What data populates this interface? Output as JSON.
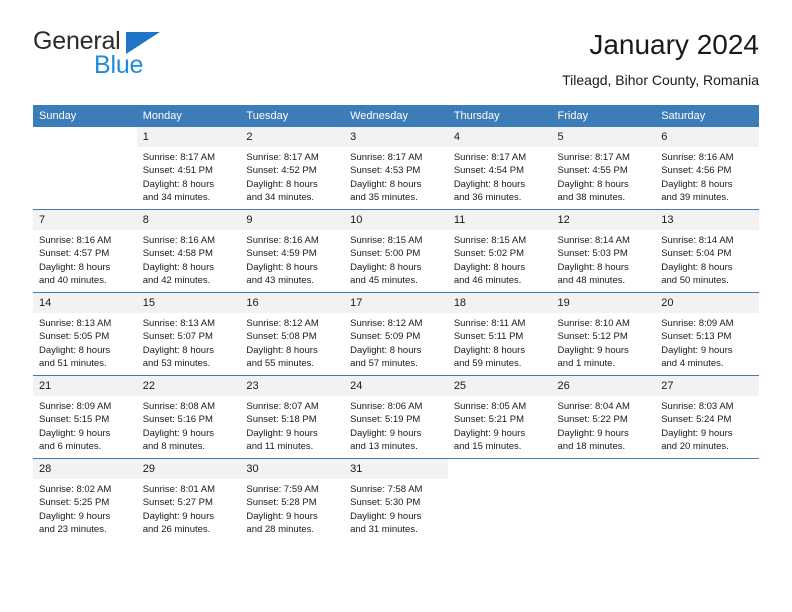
{
  "brand": {
    "name_part1": "General",
    "name_part2": "Blue",
    "triangle_color": "#1f76c6",
    "blue_color": "#1f8bdb"
  },
  "header": {
    "title": "January 2024",
    "subtitle": "Tileagd, Bihor County, Romania"
  },
  "theme": {
    "header_blue": "#3b7cb9",
    "daynum_band": "#f2f2f2",
    "text": "#1a1a1a"
  },
  "weekday_headers": [
    "Sunday",
    "Monday",
    "Tuesday",
    "Wednesday",
    "Thursday",
    "Friday",
    "Saturday"
  ],
  "weeks": [
    [
      {
        "day": "",
        "blank": true,
        "sunrise": "",
        "sunset": "",
        "daylight1": "",
        "daylight2": ""
      },
      {
        "day": "1",
        "sunrise": "Sunrise: 8:17 AM",
        "sunset": "Sunset: 4:51 PM",
        "daylight1": "Daylight: 8 hours",
        "daylight2": "and 34 minutes."
      },
      {
        "day": "2",
        "sunrise": "Sunrise: 8:17 AM",
        "sunset": "Sunset: 4:52 PM",
        "daylight1": "Daylight: 8 hours",
        "daylight2": "and 34 minutes."
      },
      {
        "day": "3",
        "sunrise": "Sunrise: 8:17 AM",
        "sunset": "Sunset: 4:53 PM",
        "daylight1": "Daylight: 8 hours",
        "daylight2": "and 35 minutes."
      },
      {
        "day": "4",
        "sunrise": "Sunrise: 8:17 AM",
        "sunset": "Sunset: 4:54 PM",
        "daylight1": "Daylight: 8 hours",
        "daylight2": "and 36 minutes."
      },
      {
        "day": "5",
        "sunrise": "Sunrise: 8:17 AM",
        "sunset": "Sunset: 4:55 PM",
        "daylight1": "Daylight: 8 hours",
        "daylight2": "and 38 minutes."
      },
      {
        "day": "6",
        "sunrise": "Sunrise: 8:16 AM",
        "sunset": "Sunset: 4:56 PM",
        "daylight1": "Daylight: 8 hours",
        "daylight2": "and 39 minutes."
      }
    ],
    [
      {
        "day": "7",
        "sunrise": "Sunrise: 8:16 AM",
        "sunset": "Sunset: 4:57 PM",
        "daylight1": "Daylight: 8 hours",
        "daylight2": "and 40 minutes."
      },
      {
        "day": "8",
        "sunrise": "Sunrise: 8:16 AM",
        "sunset": "Sunset: 4:58 PM",
        "daylight1": "Daylight: 8 hours",
        "daylight2": "and 42 minutes."
      },
      {
        "day": "9",
        "sunrise": "Sunrise: 8:16 AM",
        "sunset": "Sunset: 4:59 PM",
        "daylight1": "Daylight: 8 hours",
        "daylight2": "and 43 minutes."
      },
      {
        "day": "10",
        "sunrise": "Sunrise: 8:15 AM",
        "sunset": "Sunset: 5:00 PM",
        "daylight1": "Daylight: 8 hours",
        "daylight2": "and 45 minutes."
      },
      {
        "day": "11",
        "sunrise": "Sunrise: 8:15 AM",
        "sunset": "Sunset: 5:02 PM",
        "daylight1": "Daylight: 8 hours",
        "daylight2": "and 46 minutes."
      },
      {
        "day": "12",
        "sunrise": "Sunrise: 8:14 AM",
        "sunset": "Sunset: 5:03 PM",
        "daylight1": "Daylight: 8 hours",
        "daylight2": "and 48 minutes."
      },
      {
        "day": "13",
        "sunrise": "Sunrise: 8:14 AM",
        "sunset": "Sunset: 5:04 PM",
        "daylight1": "Daylight: 8 hours",
        "daylight2": "and 50 minutes."
      }
    ],
    [
      {
        "day": "14",
        "sunrise": "Sunrise: 8:13 AM",
        "sunset": "Sunset: 5:05 PM",
        "daylight1": "Daylight: 8 hours",
        "daylight2": "and 51 minutes."
      },
      {
        "day": "15",
        "sunrise": "Sunrise: 8:13 AM",
        "sunset": "Sunset: 5:07 PM",
        "daylight1": "Daylight: 8 hours",
        "daylight2": "and 53 minutes."
      },
      {
        "day": "16",
        "sunrise": "Sunrise: 8:12 AM",
        "sunset": "Sunset: 5:08 PM",
        "daylight1": "Daylight: 8 hours",
        "daylight2": "and 55 minutes."
      },
      {
        "day": "17",
        "sunrise": "Sunrise: 8:12 AM",
        "sunset": "Sunset: 5:09 PM",
        "daylight1": "Daylight: 8 hours",
        "daylight2": "and 57 minutes."
      },
      {
        "day": "18",
        "sunrise": "Sunrise: 8:11 AM",
        "sunset": "Sunset: 5:11 PM",
        "daylight1": "Daylight: 8 hours",
        "daylight2": "and 59 minutes."
      },
      {
        "day": "19",
        "sunrise": "Sunrise: 8:10 AM",
        "sunset": "Sunset: 5:12 PM",
        "daylight1": "Daylight: 9 hours",
        "daylight2": "and 1 minute."
      },
      {
        "day": "20",
        "sunrise": "Sunrise: 8:09 AM",
        "sunset": "Sunset: 5:13 PM",
        "daylight1": "Daylight: 9 hours",
        "daylight2": "and 4 minutes."
      }
    ],
    [
      {
        "day": "21",
        "sunrise": "Sunrise: 8:09 AM",
        "sunset": "Sunset: 5:15 PM",
        "daylight1": "Daylight: 9 hours",
        "daylight2": "and 6 minutes."
      },
      {
        "day": "22",
        "sunrise": "Sunrise: 8:08 AM",
        "sunset": "Sunset: 5:16 PM",
        "daylight1": "Daylight: 9 hours",
        "daylight2": "and 8 minutes."
      },
      {
        "day": "23",
        "sunrise": "Sunrise: 8:07 AM",
        "sunset": "Sunset: 5:18 PM",
        "daylight1": "Daylight: 9 hours",
        "daylight2": "and 11 minutes."
      },
      {
        "day": "24",
        "sunrise": "Sunrise: 8:06 AM",
        "sunset": "Sunset: 5:19 PM",
        "daylight1": "Daylight: 9 hours",
        "daylight2": "and 13 minutes."
      },
      {
        "day": "25",
        "sunrise": "Sunrise: 8:05 AM",
        "sunset": "Sunset: 5:21 PM",
        "daylight1": "Daylight: 9 hours",
        "daylight2": "and 15 minutes."
      },
      {
        "day": "26",
        "sunrise": "Sunrise: 8:04 AM",
        "sunset": "Sunset: 5:22 PM",
        "daylight1": "Daylight: 9 hours",
        "daylight2": "and 18 minutes."
      },
      {
        "day": "27",
        "sunrise": "Sunrise: 8:03 AM",
        "sunset": "Sunset: 5:24 PM",
        "daylight1": "Daylight: 9 hours",
        "daylight2": "and 20 minutes."
      }
    ],
    [
      {
        "day": "28",
        "sunrise": "Sunrise: 8:02 AM",
        "sunset": "Sunset: 5:25 PM",
        "daylight1": "Daylight: 9 hours",
        "daylight2": "and 23 minutes."
      },
      {
        "day": "29",
        "sunrise": "Sunrise: 8:01 AM",
        "sunset": "Sunset: 5:27 PM",
        "daylight1": "Daylight: 9 hours",
        "daylight2": "and 26 minutes."
      },
      {
        "day": "30",
        "sunrise": "Sunrise: 7:59 AM",
        "sunset": "Sunset: 5:28 PM",
        "daylight1": "Daylight: 9 hours",
        "daylight2": "and 28 minutes."
      },
      {
        "day": "31",
        "sunrise": "Sunrise: 7:58 AM",
        "sunset": "Sunset: 5:30 PM",
        "daylight1": "Daylight: 9 hours",
        "daylight2": "and 31 minutes."
      },
      {
        "day": "",
        "blank": true,
        "sunrise": "",
        "sunset": "",
        "daylight1": "",
        "daylight2": ""
      },
      {
        "day": "",
        "blank": true,
        "sunrise": "",
        "sunset": "",
        "daylight1": "",
        "daylight2": ""
      },
      {
        "day": "",
        "blank": true,
        "sunrise": "",
        "sunset": "",
        "daylight1": "",
        "daylight2": ""
      }
    ]
  ]
}
